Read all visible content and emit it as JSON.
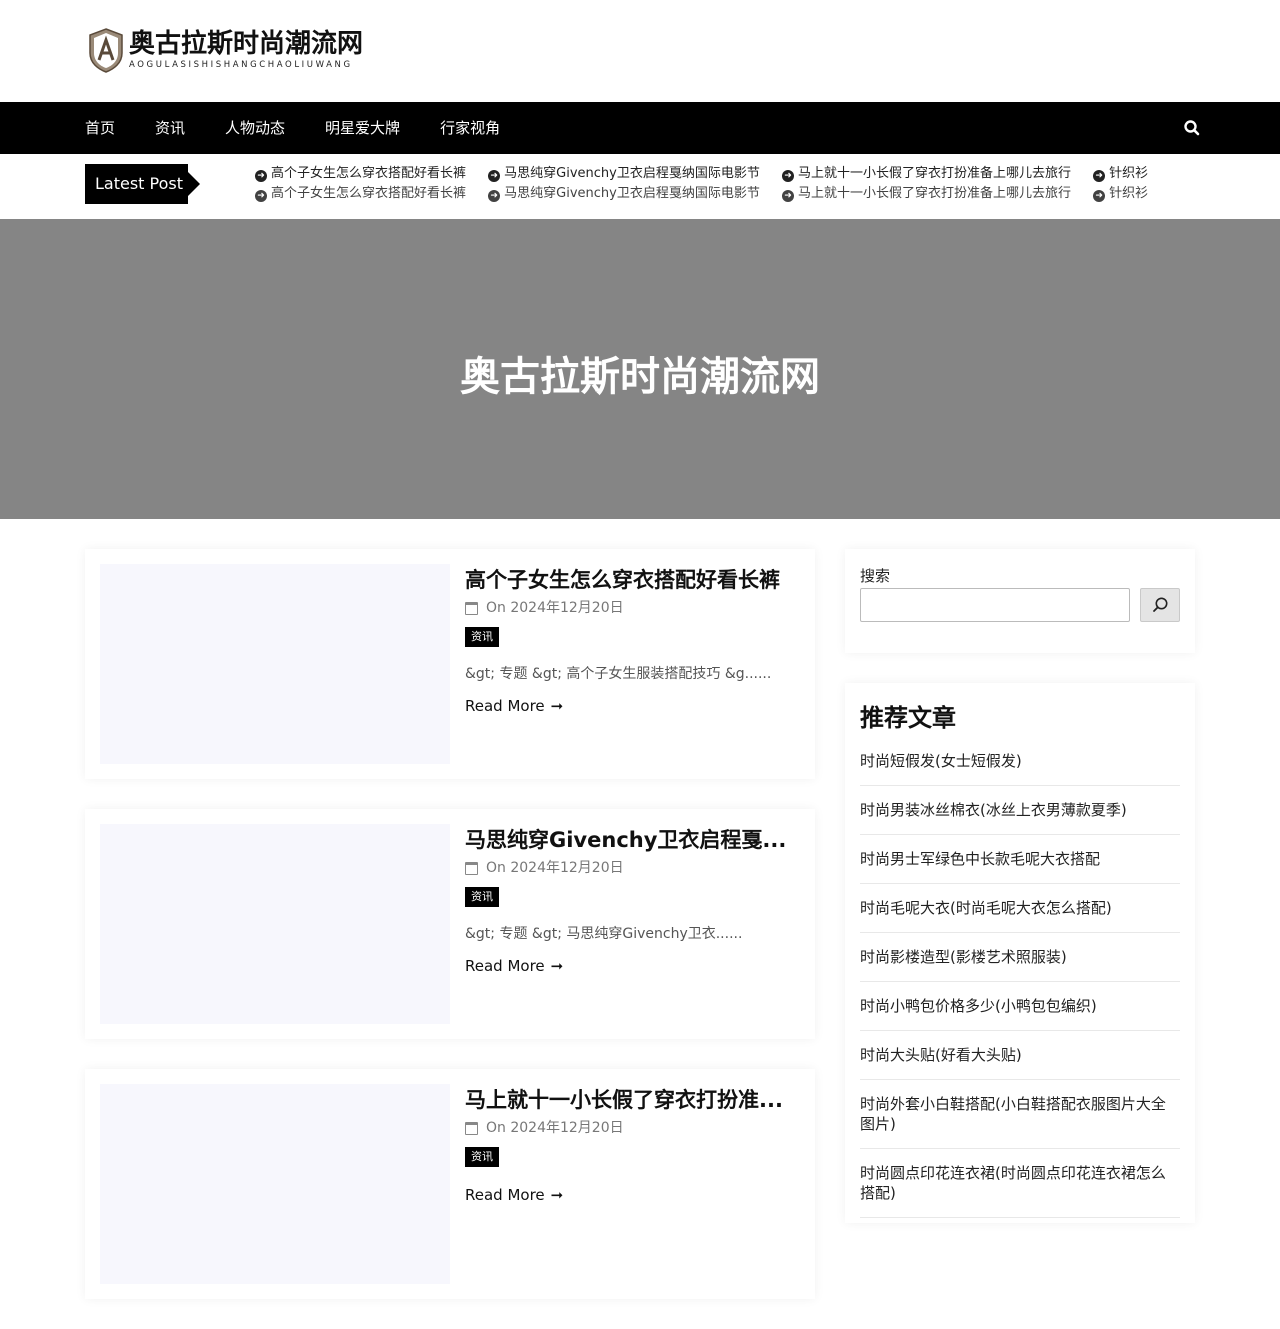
{
  "logo": {
    "title": "奥古拉斯时尚潮流网",
    "subtitle": "AOGULASISHISHANGCHAOLIUWANG"
  },
  "nav": {
    "items": [
      {
        "label": "首页"
      },
      {
        "label": "资讯"
      },
      {
        "label": "人物动态"
      },
      {
        "label": "明星爱大牌"
      },
      {
        "label": "行家视角"
      }
    ],
    "search_icon": "search-icon"
  },
  "ticker": {
    "label": "Latest Post",
    "items": [
      "高个子女生怎么穿衣搭配好看长裤",
      "马思纯穿Givenchy卫衣启程戛纳国际电影节",
      "马上就十一小长假了穿衣打扮准备上哪儿去旅行",
      "针织衫"
    ]
  },
  "hero": {
    "title": "奥古拉斯时尚潮流网"
  },
  "posts": [
    {
      "title": "高个子女生怎么穿衣搭配好看长裤",
      "date": "On 2024年12月20日",
      "category": "资讯",
      "excerpt": "&gt; 专题 &gt; 高个子女生服装搭配技巧 &g......",
      "read_more": "Read More"
    },
    {
      "title": "马思纯穿Givenchy卫衣启程戛...",
      "date": "On 2024年12月20日",
      "category": "资讯",
      "excerpt": "&gt; 专题 &gt; 马思纯穿Givenchy卫衣......",
      "read_more": "Read More"
    },
    {
      "title": "马上就十一小长假了穿衣打扮准...",
      "date": "On 2024年12月20日",
      "category": "资讯",
      "excerpt": "",
      "read_more": "Read More"
    }
  ],
  "sidebar": {
    "search_label": "搜索",
    "search_placeholder": "",
    "recommend_title": "推荐文章",
    "recommend_items": [
      "时尚短假发(女士短假发)",
      "时尚男装冰丝棉衣(冰丝上衣男薄款夏季)",
      "时尚男士军绿色中长款毛呢大衣搭配",
      "时尚毛呢大衣(时尚毛呢大衣怎么搭配)",
      "时尚影楼造型(影楼艺术照服装)",
      "时尚小鸭包价格多少(小鸭包包编织)",
      "时尚大头贴(好看大头贴)",
      "时尚外套小白鞋搭配(小白鞋搭配衣服图片大全图片)",
      "时尚圆点印花连衣裙(时尚圆点印花连衣裙怎么搭配)"
    ]
  },
  "colors": {
    "nav_bg": "#000000",
    "hero_bg": "#858585",
    "thumb_bg": "#f7f7fd"
  }
}
